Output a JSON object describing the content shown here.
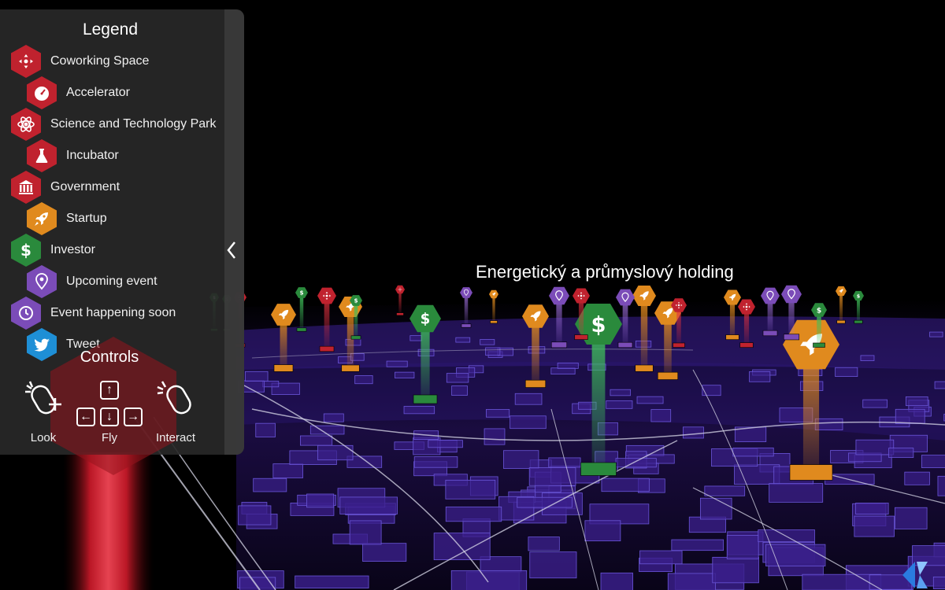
{
  "legend": {
    "title": "Legend",
    "items": [
      {
        "label": "Coworking Space",
        "icon": "coworking-icon",
        "color": "#c0222e"
      },
      {
        "label": "Accelerator",
        "icon": "speedometer-icon",
        "color": "#c0222e"
      },
      {
        "label": "Science and Technology Park",
        "icon": "atom-icon",
        "color": "#c0222e"
      },
      {
        "label": "Incubator",
        "icon": "flask-icon",
        "color": "#c0222e"
      },
      {
        "label": "Government",
        "icon": "bank-icon",
        "color": "#c0222e"
      },
      {
        "label": "Startup",
        "icon": "rocket-icon",
        "color": "#e08a1e"
      },
      {
        "label": "Investor",
        "icon": "dollar-icon",
        "color": "#2a8a3c"
      },
      {
        "label": "Upcoming event",
        "icon": "map-pin-icon",
        "color": "#7b4cb8"
      },
      {
        "label": "Event happening soon",
        "icon": "clock-icon",
        "color": "#7b4cb8"
      },
      {
        "label": "Tweet",
        "icon": "twitter-bird-icon",
        "color": "#1e8fd6"
      }
    ]
  },
  "controls": {
    "title": "Controls",
    "look_label": "Look",
    "fly_label": "Fly",
    "interact_label": "Interact",
    "keys": {
      "up": "↑",
      "left": "←",
      "down": "↓",
      "right": "→"
    }
  },
  "hover_label": "Energetický a průmyslový holding",
  "colors": {
    "red": "#c0222e",
    "orange": "#e08a1e",
    "green": "#2a8a3c",
    "purple": "#7b4cb8",
    "blue": "#1e8fd6",
    "buildings": "#3a1f8a"
  }
}
